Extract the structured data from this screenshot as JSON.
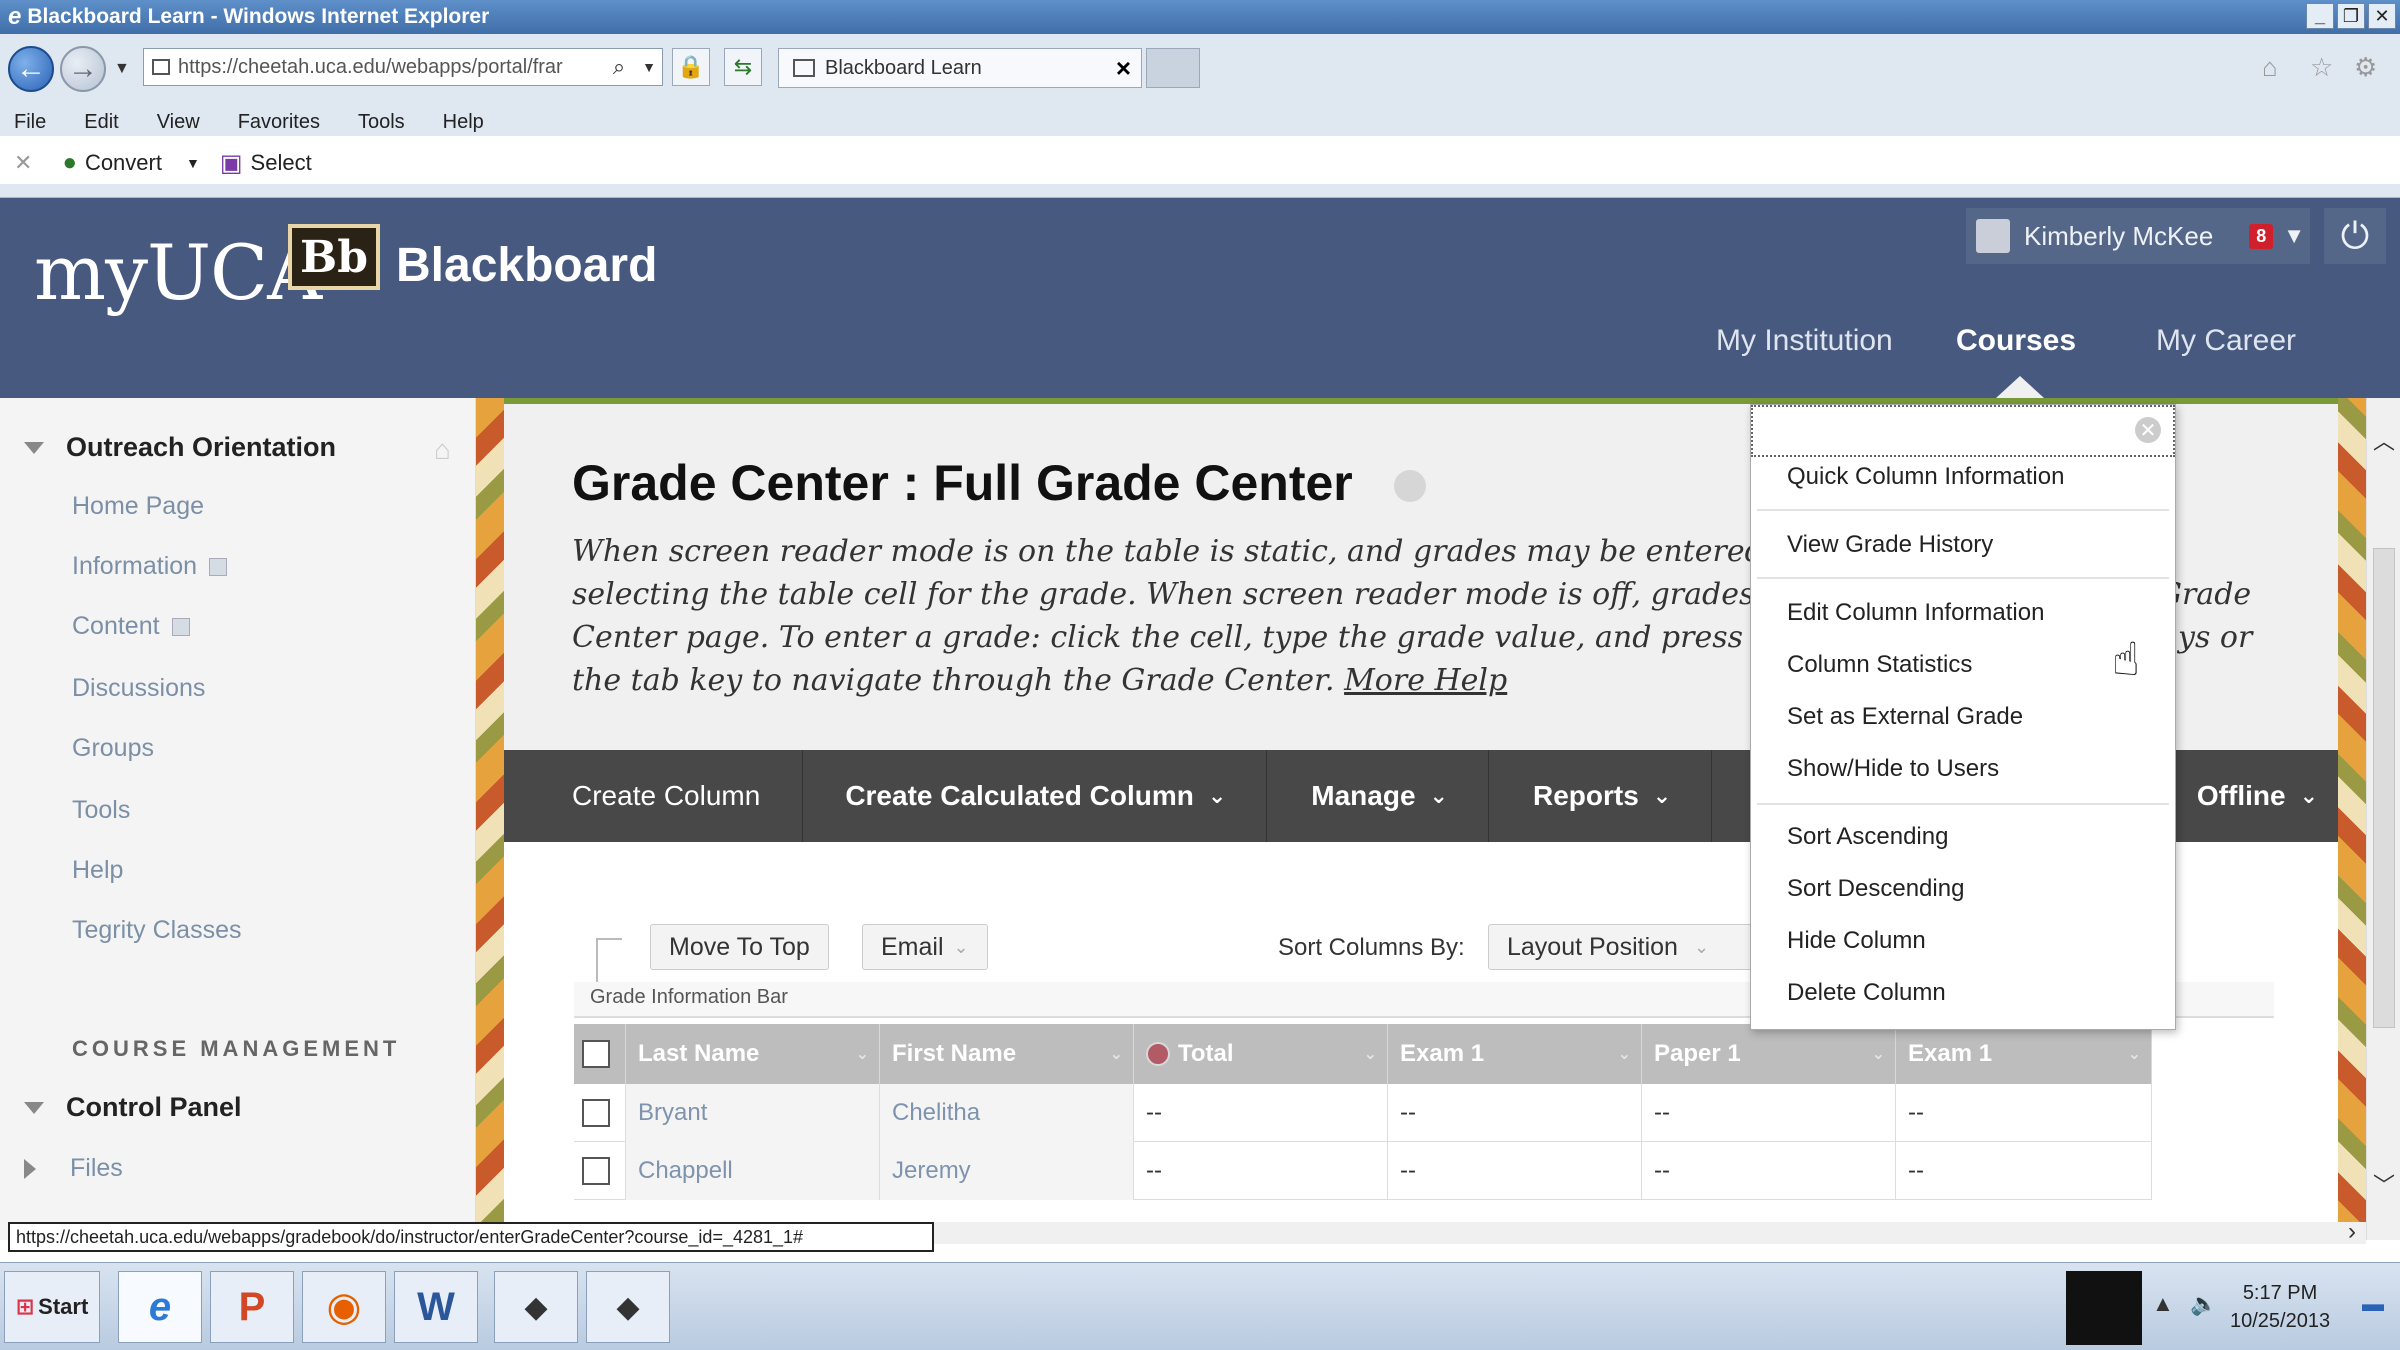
{
  "browser": {
    "window_title": "Blackboard Learn - Windows Internet Explorer",
    "address": "https://cheetah.uca.edu/webapps/portal/frar",
    "tab_title": "Blackboard Learn",
    "tab_close": "×",
    "menu": [
      "File",
      "Edit",
      "View",
      "Favorites",
      "Tools",
      "Help"
    ],
    "cmd_convert": "Convert",
    "cmd_select": "Select"
  },
  "header": {
    "logo_my": "myUCA",
    "logo_bb": "Bb",
    "logo_text": "Blackboard",
    "user_name": "Kimberly McKee",
    "notifications": "8",
    "tabs": [
      "My Institution",
      "Courses",
      "My Career"
    ],
    "active_tab": "Courses"
  },
  "leftnav": {
    "course_title": "Outreach Orientation",
    "items": [
      "Home Page",
      "Information",
      "Content",
      "Discussions",
      "Groups",
      "Tools",
      "Help",
      "Tegrity Classes"
    ],
    "section_label": "COURSE MANAGEMENT",
    "control_panel": "Control Panel",
    "files": "Files"
  },
  "main": {
    "title": "Grade Center : Full Grade Center",
    "description_l1": "When screen reader mode is on the table is static, and grades may be entered on the Gr",
    "description_l2": "selecting the table cell for the grade. When screen reader mode is off, grades can be typ",
    "description_l3": "Center page. To enter a grade: click the cell, type the grade value, and press the Enter k",
    "description_l4": "the tab key to navigate through the Grade Center.",
    "description_tail2": "Grade",
    "description_tail3": "ys or",
    "more_help": "More Help",
    "actions": [
      "Create Column",
      "Create Calculated Column",
      "Manage",
      "Reports"
    ],
    "action_offline": "Offline",
    "tool_move_top": "Move To Top",
    "tool_email": "Email",
    "sort_label": "Sort Columns By:",
    "sort_value": "Layout Position",
    "grade_info_bar": "Grade Information Bar"
  },
  "grid": {
    "columns": [
      "Last Name",
      "First Name",
      "Total",
      "Exam 1",
      "Paper 1",
      "Exam 1"
    ],
    "rows": [
      [
        "Bryant",
        "Chelitha",
        "--",
        "--",
        "--",
        "--"
      ],
      [
        "Chappell",
        "Jeremy",
        "--",
        "--",
        "--",
        "--"
      ]
    ]
  },
  "context_menu": {
    "items_group1": [
      "Quick Column Information",
      "View Grade History"
    ],
    "items_group2": [
      "Edit Column Information",
      "Column Statistics",
      "Set as External Grade",
      "Show/Hide to Users"
    ],
    "items_group3": [
      "Sort Ascending",
      "Sort Descending",
      "Hide Column",
      "Delete Column"
    ]
  },
  "status_url": "https://cheetah.uca.edu/webapps/gradebook/do/instructor/enterGradeCenter?course_id=_4281_1#",
  "taskbar": {
    "start": "Start",
    "time": "5:17 PM",
    "date": "10/25/2013"
  },
  "colors": {
    "header_bg": "#47597f",
    "action_bar": "#484848",
    "accent_green": "#7a9a3a"
  }
}
